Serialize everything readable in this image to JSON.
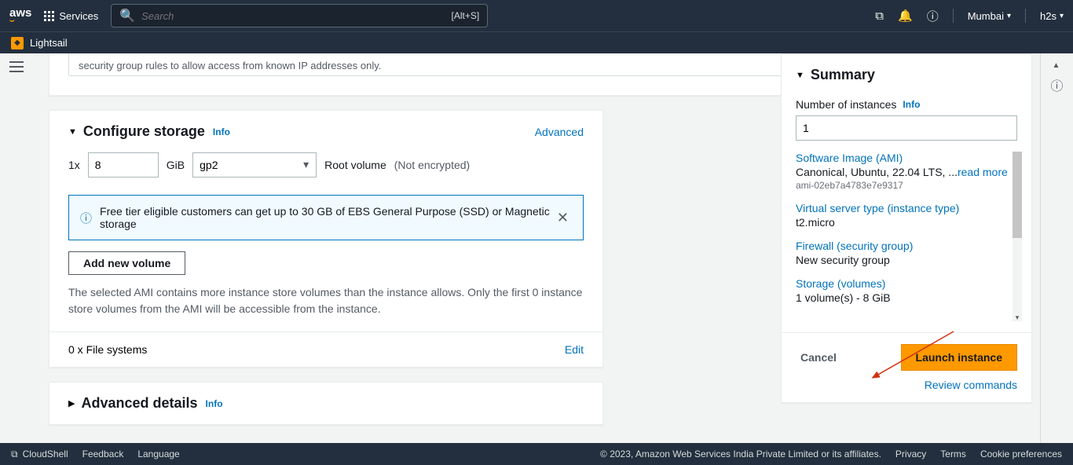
{
  "topnav": {
    "services_label": "Services",
    "search_placeholder": "Search",
    "search_shortcut": "[Alt+S]",
    "region": "Mumbai",
    "user": "h2s"
  },
  "secondbar": {
    "lightsail": "Lightsail"
  },
  "sg_fragment": "security group rules to allow access from known IP addresses only.",
  "storage": {
    "title": "Configure storage",
    "info": "Info",
    "advanced": "Advanced",
    "multiplier": "1x",
    "size": "8",
    "size_unit": "GiB",
    "volume_type": "gp2",
    "root_label": "Root volume",
    "encrypted_label": "(Not encrypted)",
    "free_tier": "Free tier eligible customers can get up to 30 GB of EBS General Purpose (SSD) or Magnetic storage",
    "add_volume": "Add new volume",
    "ami_store_text": "The selected AMI contains more instance store volumes than the instance allows. Only the first 0 instance store volumes from the AMI will be accessible from the instance.",
    "fs_label": "0 x File systems",
    "edit": "Edit"
  },
  "advanced_details": {
    "title": "Advanced details",
    "info": "Info"
  },
  "summary": {
    "title": "Summary",
    "num_label": "Number of instances",
    "info": "Info",
    "num_value": "1",
    "ami_link": "Software Image (AMI)",
    "ami_desc": "Canonical, Ubuntu, 22.04 LTS, ...",
    "read_more": "read more",
    "ami_id": "ami-02eb7a4783e7e9317",
    "instance_type_link": "Virtual server type (instance type)",
    "instance_type": "t2.micro",
    "firewall_link": "Firewall (security group)",
    "firewall_val": "New security group",
    "storage_link": "Storage (volumes)",
    "storage_val": "1 volume(s) - 8 GiB",
    "cancel": "Cancel",
    "launch": "Launch instance",
    "review": "Review commands"
  },
  "footer": {
    "cloudshell": "CloudShell",
    "feedback": "Feedback",
    "language": "Language",
    "copyright": "© 2023, Amazon Web Services India Private Limited or its affiliates.",
    "privacy": "Privacy",
    "terms": "Terms",
    "cookies": "Cookie preferences"
  }
}
